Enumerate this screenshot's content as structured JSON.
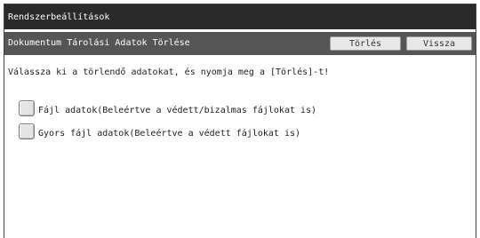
{
  "window": {
    "title": "Rendszerbeállítások"
  },
  "header": {
    "title": "Dokumentum Tárolási Adatok Törlése",
    "delete_label": "Törlés",
    "back_label": "Vissza"
  },
  "main": {
    "instruction": "Válassza ki a törlendő adatokat, és nyomja meg a [Törlés]-t!",
    "options": [
      {
        "label": "Fájl adatok(Beleértve a védett/bizalmas fájlokat is)",
        "checked": false
      },
      {
        "label": "Gyors fájl adatok(Beleértve a védett fájlokat is)",
        "checked": false
      }
    ]
  }
}
